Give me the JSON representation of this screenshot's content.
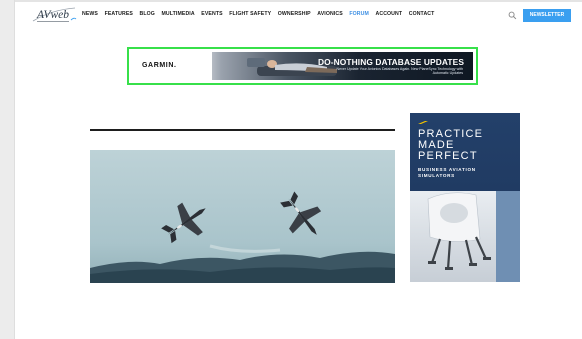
{
  "header": {
    "logo_text": "AVweb",
    "nav": [
      {
        "label": "NEWS",
        "active": false
      },
      {
        "label": "FEATURES",
        "active": false
      },
      {
        "label": "BLOG",
        "active": false
      },
      {
        "label": "MULTIMEDIA",
        "active": false
      },
      {
        "label": "EVENTS",
        "active": false
      },
      {
        "label": "FLIGHT SAFETY",
        "active": false
      },
      {
        "label": "OWNERSHIP",
        "active": false
      },
      {
        "label": "AVIONICS",
        "active": false
      },
      {
        "label": "FORUM",
        "active": true
      },
      {
        "label": "ACCOUNT",
        "active": false
      },
      {
        "label": "CONTACT",
        "active": false
      }
    ],
    "search_icon": "search-icon",
    "newsletter_label": "NEWSLETTER"
  },
  "top_ad": {
    "brand": "GARMIN.",
    "title": "DO-NOTHING DATABASE UPDATES",
    "subtitle": "Never Update Your Avionics Databases Again. New PlaneSync Technology with Automatic Updates"
  },
  "side_ad": {
    "title_lines": [
      "PRACTICE",
      "MADE",
      "PERFECT"
    ],
    "sub_lines": [
      "BUSINESS AVIATION",
      "SIMULATORS"
    ]
  },
  "colors": {
    "accent": "#3a9ff0",
    "active_nav": "#3d8fe3",
    "ad_highlight": "#37e04a",
    "side_ad_bg": "#2a4a72"
  }
}
